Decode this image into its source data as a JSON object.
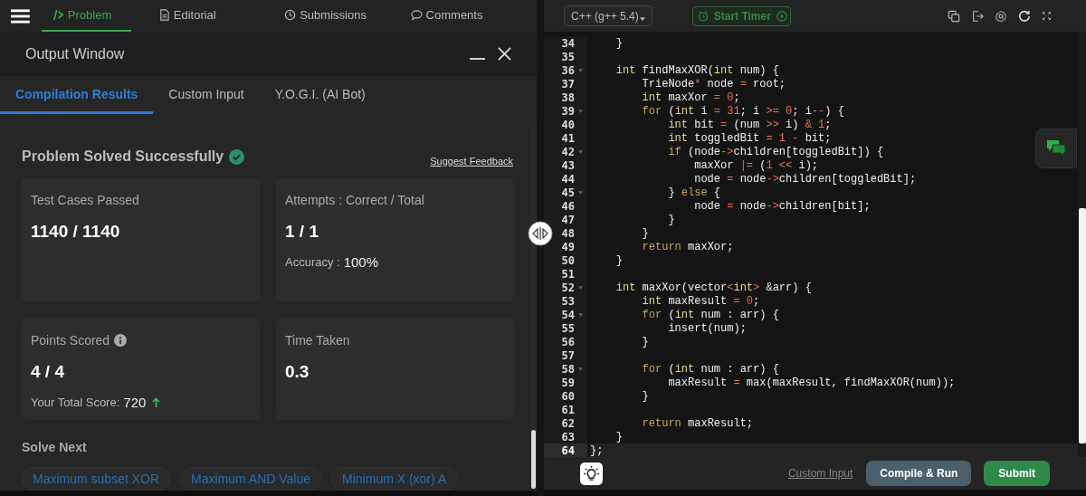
{
  "nav": {
    "tabs": [
      {
        "label": "Problem",
        "selected": true
      },
      {
        "label": "Editorial",
        "selected": false
      },
      {
        "label": "Submissions",
        "selected": false
      },
      {
        "label": "Comments",
        "selected": false
      }
    ]
  },
  "output_window": {
    "title": "Output Window",
    "tabs": [
      {
        "label": "Compilation Results",
        "selected": true
      },
      {
        "label": "Custom Input",
        "selected": false
      },
      {
        "label": "Y.O.G.I. (AI Bot)",
        "selected": false
      }
    ],
    "status": "Problem Solved Successfully",
    "solved": true,
    "feedback_link": "Suggest Feedback",
    "cards": [
      {
        "title": "Test Cases Passed",
        "value": "1140 / 1140",
        "info": false
      },
      {
        "title": "Attempts : Correct / Total",
        "value": "1 / 1",
        "note_label": "Accuracy :",
        "note_value": "100%",
        "info": false
      },
      {
        "title": "Points Scored",
        "value": "4 / 4",
        "note_label": "Your Total Score:",
        "note_value": "720",
        "rising": true,
        "info": true
      },
      {
        "title": "Time Taken",
        "value": "0.3",
        "info": false
      }
    ],
    "solve_next": {
      "title": "Solve Next",
      "problems": [
        "Maximum subset XOR",
        "Maximum AND Value",
        "Minimum X (xor) A"
      ]
    }
  },
  "editor": {
    "language": "C++ (g++ 5.4)",
    "timer_button": "Start Timer",
    "lines": [
      {
        "number": "34",
        "foldable": false,
        "active": false,
        "tokens": [
          {
            "kind": "plain",
            "text": "    }"
          }
        ]
      },
      {
        "number": "35",
        "foldable": false,
        "active": false
      },
      {
        "number": "36",
        "foldable": true,
        "active": false,
        "tokens": [
          {
            "kind": "type",
            "text": "    int"
          },
          {
            "kind": "plain",
            "text": " findMaxXOR("
          },
          {
            "kind": "type",
            "text": "int"
          },
          {
            "kind": "plain",
            "text": " num) {"
          }
        ]
      },
      {
        "number": "37",
        "foldable": false,
        "active": false,
        "tokens": [
          {
            "kind": "plain",
            "text": "        TrieNode"
          },
          {
            "kind": "operator",
            "text": "*"
          },
          {
            "kind": "plain",
            "text": " node "
          },
          {
            "kind": "operator",
            "text": "="
          },
          {
            "kind": "plain",
            "text": " root;"
          }
        ]
      },
      {
        "number": "38",
        "foldable": false,
        "active": false,
        "tokens": [
          {
            "kind": "type",
            "text": "        int"
          },
          {
            "kind": "plain",
            "text": " maxXor "
          },
          {
            "kind": "operator",
            "text": "="
          },
          {
            "kind": "number",
            "text": " 0"
          },
          {
            "kind": "plain",
            "text": ";"
          }
        ]
      },
      {
        "number": "39",
        "foldable": true,
        "active": false,
        "tokens": [
          {
            "kind": "control",
            "text": "        for"
          },
          {
            "kind": "plain",
            "text": " ("
          },
          {
            "kind": "type",
            "text": "int"
          },
          {
            "kind": "plain",
            "text": " i "
          },
          {
            "kind": "operator",
            "text": "="
          },
          {
            "kind": "number",
            "text": " 31"
          },
          {
            "kind": "plain",
            "text": "; i "
          },
          {
            "kind": "operator",
            "text": ">="
          },
          {
            "kind": "number",
            "text": " 0"
          },
          {
            "kind": "plain",
            "text": "; i"
          },
          {
            "kind": "operator",
            "text": "--"
          },
          {
            "kind": "plain",
            "text": ") {"
          }
        ]
      },
      {
        "number": "40",
        "foldable": false,
        "active": false,
        "tokens": [
          {
            "kind": "type",
            "text": "            int"
          },
          {
            "kind": "plain",
            "text": " bit "
          },
          {
            "kind": "operator",
            "text": "="
          },
          {
            "kind": "plain",
            "text": " (num "
          },
          {
            "kind": "operator",
            "text": ">>"
          },
          {
            "kind": "plain",
            "text": " i) "
          },
          {
            "kind": "operator",
            "text": "&"
          },
          {
            "kind": "number",
            "text": " 1"
          },
          {
            "kind": "plain",
            "text": ";"
          }
        ]
      },
      {
        "number": "41",
        "foldable": false,
        "active": false,
        "tokens": [
          {
            "kind": "type",
            "text": "            int"
          },
          {
            "kind": "plain",
            "text": " toggledBit "
          },
          {
            "kind": "operator",
            "text": "="
          },
          {
            "kind": "number",
            "text": " 1"
          },
          {
            "kind": "operator",
            "text": " -"
          },
          {
            "kind": "plain",
            "text": " bit;"
          }
        ]
      },
      {
        "number": "42",
        "foldable": true,
        "active": false,
        "tokens": [
          {
            "kind": "control",
            "text": "            if"
          },
          {
            "kind": "plain",
            "text": " (node"
          },
          {
            "kind": "operator",
            "text": "->"
          },
          {
            "kind": "plain",
            "text": "children[toggledBit]) {"
          }
        ]
      },
      {
        "number": "43",
        "foldable": false,
        "active": false,
        "tokens": [
          {
            "kind": "plain",
            "text": "                maxXor "
          },
          {
            "kind": "operator",
            "text": "|="
          },
          {
            "kind": "plain",
            "text": " ("
          },
          {
            "kind": "number",
            "text": "1"
          },
          {
            "kind": "operator",
            "text": " <<"
          },
          {
            "kind": "plain",
            "text": " i);"
          }
        ]
      },
      {
        "number": "44",
        "foldable": false,
        "active": false,
        "tokens": [
          {
            "kind": "plain",
            "text": "                node "
          },
          {
            "kind": "operator",
            "text": "="
          },
          {
            "kind": "plain",
            "text": " node"
          },
          {
            "kind": "operator",
            "text": "->"
          },
          {
            "kind": "plain",
            "text": "children[toggledBit];"
          }
        ]
      },
      {
        "number": "45",
        "foldable": true,
        "active": false,
        "tokens": [
          {
            "kind": "plain",
            "text": "            } "
          },
          {
            "kind": "control",
            "text": "else"
          },
          {
            "kind": "plain",
            "text": " {"
          }
        ]
      },
      {
        "number": "46",
        "foldable": false,
        "active": false,
        "tokens": [
          {
            "kind": "plain",
            "text": "                node "
          },
          {
            "kind": "operator",
            "text": "="
          },
          {
            "kind": "plain",
            "text": " node"
          },
          {
            "kind": "operator",
            "text": "->"
          },
          {
            "kind": "plain",
            "text": "children[bit];"
          }
        ]
      },
      {
        "number": "47",
        "foldable": false,
        "active": false,
        "tokens": [
          {
            "kind": "plain",
            "text": "            }"
          }
        ]
      },
      {
        "number": "48",
        "foldable": false,
        "active": false,
        "tokens": [
          {
            "kind": "plain",
            "text": "        }"
          }
        ]
      },
      {
        "number": "49",
        "foldable": false,
        "active": false,
        "tokens": [
          {
            "kind": "control",
            "text": "        return"
          },
          {
            "kind": "plain",
            "text": " maxXor;"
          }
        ]
      },
      {
        "number": "50",
        "foldable": false,
        "active": false,
        "tokens": [
          {
            "kind": "plain",
            "text": "    }"
          }
        ]
      },
      {
        "number": "51",
        "foldable": false,
        "active": false
      },
      {
        "number": "52",
        "foldable": true,
        "active": false,
        "tokens": [
          {
            "kind": "type",
            "text": "    int"
          },
          {
            "kind": "plain",
            "text": " maxXor(vector"
          },
          {
            "kind": "operator",
            "text": "<"
          },
          {
            "kind": "type",
            "text": "int"
          },
          {
            "kind": "operator",
            "text": ">"
          },
          {
            "kind": "plain",
            "text": " &arr) {"
          }
        ]
      },
      {
        "number": "53",
        "foldable": false,
        "active": false,
        "tokens": [
          {
            "kind": "type",
            "text": "        int"
          },
          {
            "kind": "plain",
            "text": " maxResult "
          },
          {
            "kind": "operator",
            "text": "="
          },
          {
            "kind": "number",
            "text": " 0"
          },
          {
            "kind": "plain",
            "text": ";"
          }
        ]
      },
      {
        "number": "54",
        "foldable": true,
        "active": false,
        "tokens": [
          {
            "kind": "control",
            "text": "        for"
          },
          {
            "kind": "plain",
            "text": " ("
          },
          {
            "kind": "type",
            "text": "int"
          },
          {
            "kind": "plain",
            "text": " num : arr) {"
          }
        ]
      },
      {
        "number": "55",
        "foldable": false,
        "active": false,
        "tokens": [
          {
            "kind": "plain",
            "text": "            insert(num);"
          }
        ]
      },
      {
        "number": "56",
        "foldable": false,
        "active": false,
        "tokens": [
          {
            "kind": "plain",
            "text": "        }"
          }
        ]
      },
      {
        "number": "57",
        "foldable": false,
        "active": false
      },
      {
        "number": "58",
        "foldable": true,
        "active": false,
        "tokens": [
          {
            "kind": "control",
            "text": "        for"
          },
          {
            "kind": "plain",
            "text": " ("
          },
          {
            "kind": "type",
            "text": "int"
          },
          {
            "kind": "plain",
            "text": " num : arr) {"
          }
        ]
      },
      {
        "number": "59",
        "foldable": false,
        "active": false,
        "tokens": [
          {
            "kind": "plain",
            "text": "            maxResult "
          },
          {
            "kind": "operator",
            "text": "="
          },
          {
            "kind": "plain",
            "text": " max(maxResult, findMaxXOR(num));"
          }
        ]
      },
      {
        "number": "60",
        "foldable": false,
        "active": false,
        "tokens": [
          {
            "kind": "plain",
            "text": "        }"
          }
        ]
      },
      {
        "number": "61",
        "foldable": false,
        "active": false
      },
      {
        "number": "62",
        "foldable": false,
        "active": false,
        "tokens": [
          {
            "kind": "control",
            "text": "        return"
          },
          {
            "kind": "plain",
            "text": " maxResult;"
          }
        ]
      },
      {
        "number": "63",
        "foldable": false,
        "active": false,
        "tokens": [
          {
            "kind": "plain",
            "text": "    }"
          }
        ]
      },
      {
        "number": "64",
        "foldable": false,
        "active": true,
        "tokens": [
          {
            "kind": "plain",
            "text": "};"
          }
        ]
      }
    ],
    "custom_input_link": "Custom Input",
    "compile_button": "Compile & Run",
    "submit_button": "Submit"
  }
}
